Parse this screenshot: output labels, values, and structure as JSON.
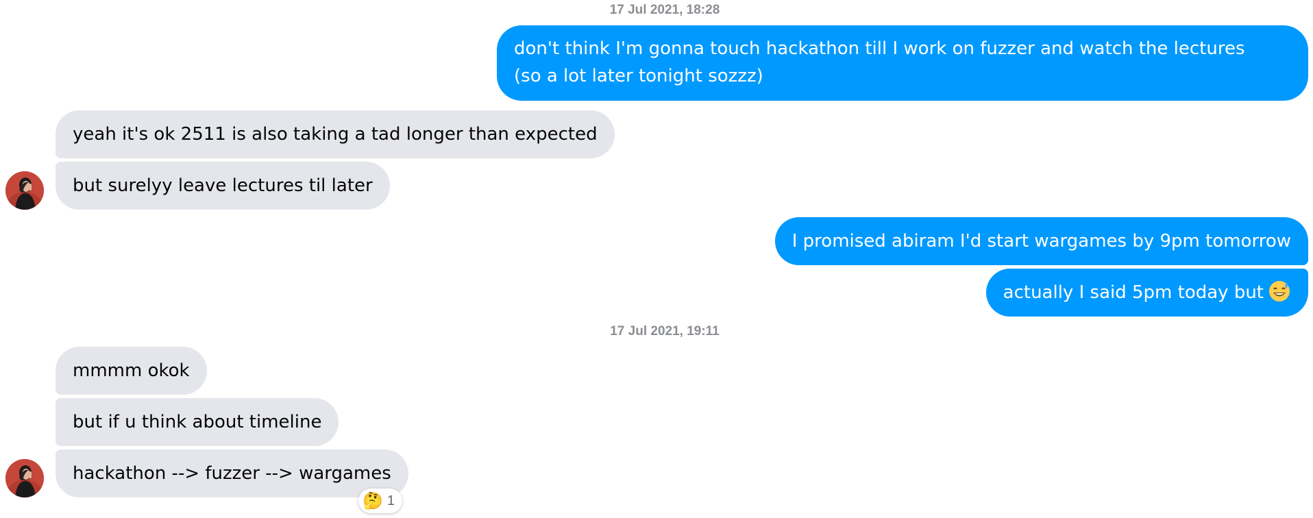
{
  "timestamps": [
    "17 Jul 2021, 18:28",
    "17 Jul 2021, 19:11"
  ],
  "messages": [
    {
      "sender": "me",
      "lines": [
        "don't think I'm gonna touch hackathon till I work on fuzzer and watch the lectures",
        "(so a lot later tonight sozzz)"
      ]
    },
    {
      "sender": "them",
      "text": "yeah it's ok 2511 is also taking a tad longer than expected"
    },
    {
      "sender": "them",
      "text": "but surelyy leave lectures til later"
    },
    {
      "sender": "me",
      "text": "I promised abiram I'd start wargames by 9pm tomorrow"
    },
    {
      "sender": "me",
      "text": "actually I said 5pm today but",
      "emoji": "sweat-smile-emoji"
    },
    {
      "sender": "them",
      "text": "mmmm okok"
    },
    {
      "sender": "them",
      "text": "but if u think about timeline"
    },
    {
      "sender": "them",
      "text": "hackathon --> fuzzer --> wargames",
      "reaction": {
        "emoji": "🤔",
        "icon": "thinking-face-emoji",
        "count": "1"
      }
    }
  ],
  "colors": {
    "outgoing_bubble": "#0099ff",
    "incoming_bubble": "#e4e6eb",
    "timestamp": "#8a8d91"
  }
}
